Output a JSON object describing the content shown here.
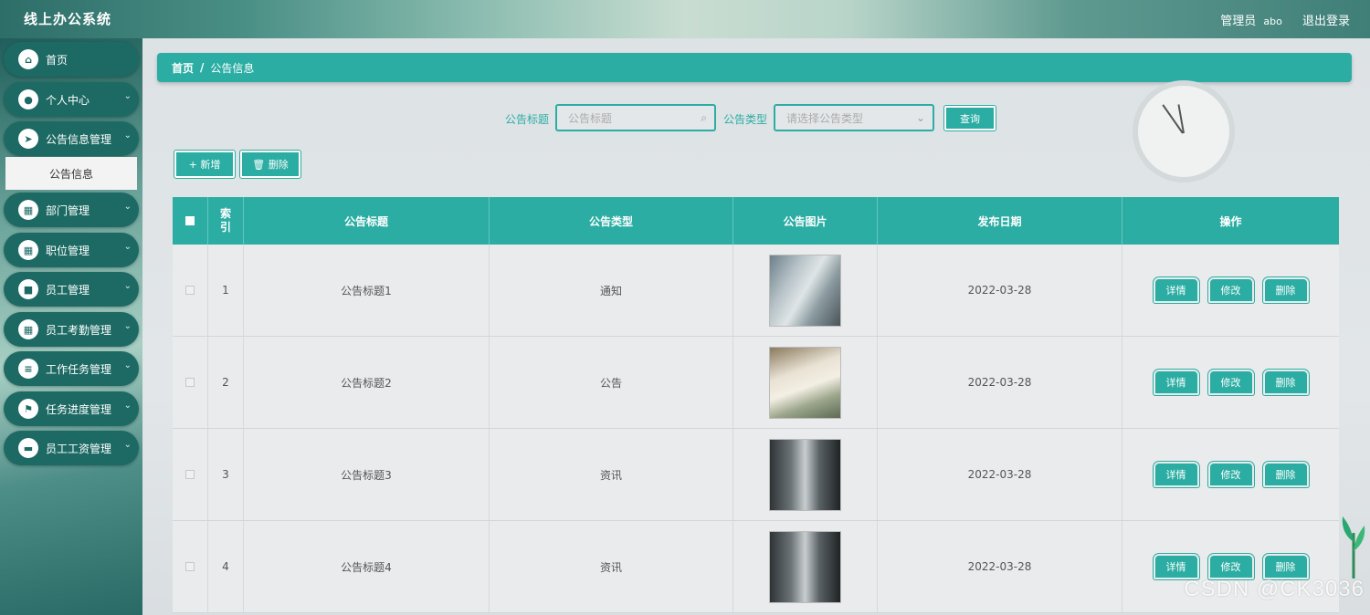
{
  "header": {
    "title": "线上办公系统",
    "role": "管理员",
    "username": "abo",
    "logout_label": "退出登录"
  },
  "sidebar": {
    "items": [
      {
        "label": "首页",
        "icon": "home-icon"
      },
      {
        "label": "个人中心",
        "icon": "user-icon"
      },
      {
        "label": "公告信息管理",
        "icon": "send-icon"
      },
      {
        "label": "部门管理",
        "icon": "grid-icon"
      },
      {
        "label": "职位管理",
        "icon": "grid-icon"
      },
      {
        "label": "员工管理",
        "icon": "briefcase-icon"
      },
      {
        "label": "员工考勤管理",
        "icon": "grid-icon"
      },
      {
        "label": "工作任务管理",
        "icon": "sliders-icon"
      },
      {
        "label": "任务进度管理",
        "icon": "flag-icon"
      },
      {
        "label": "员工工资管理",
        "icon": "wallet-icon"
      }
    ],
    "active_sub": "公告信息"
  },
  "breadcrumb": {
    "home": "首页",
    "separator": "/",
    "current": "公告信息"
  },
  "search": {
    "title_label": "公告标题",
    "title_placeholder": "公告标题",
    "type_label": "公告类型",
    "type_placeholder": "请选择公告类型",
    "query_button": "查询"
  },
  "toolbar": {
    "add_label": "+ 新增",
    "delete_label": "🗑 删除"
  },
  "table": {
    "headers": [
      "索引",
      "公告标题",
      "公告类型",
      "公告图片",
      "发布日期",
      "操作"
    ],
    "index_header_wrapped": [
      "索",
      "引"
    ],
    "rows": [
      {
        "index": "1",
        "title": "公告标题1",
        "type": "通知",
        "date": "2022-03-28"
      },
      {
        "index": "2",
        "title": "公告标题2",
        "type": "公告",
        "date": "2022-03-28"
      },
      {
        "index": "3",
        "title": "公告标题3",
        "type": "资讯",
        "date": "2022-03-28"
      },
      {
        "index": "4",
        "title": "公告标题4",
        "type": "资讯",
        "date": "2022-03-28"
      }
    ],
    "actions": {
      "detail": "详情",
      "edit": "修改",
      "delete": "删除"
    }
  },
  "watermark": "CSDN @CK3036",
  "colors": {
    "accent": "#2bada3",
    "sidebar_item": "#1d6a64"
  }
}
